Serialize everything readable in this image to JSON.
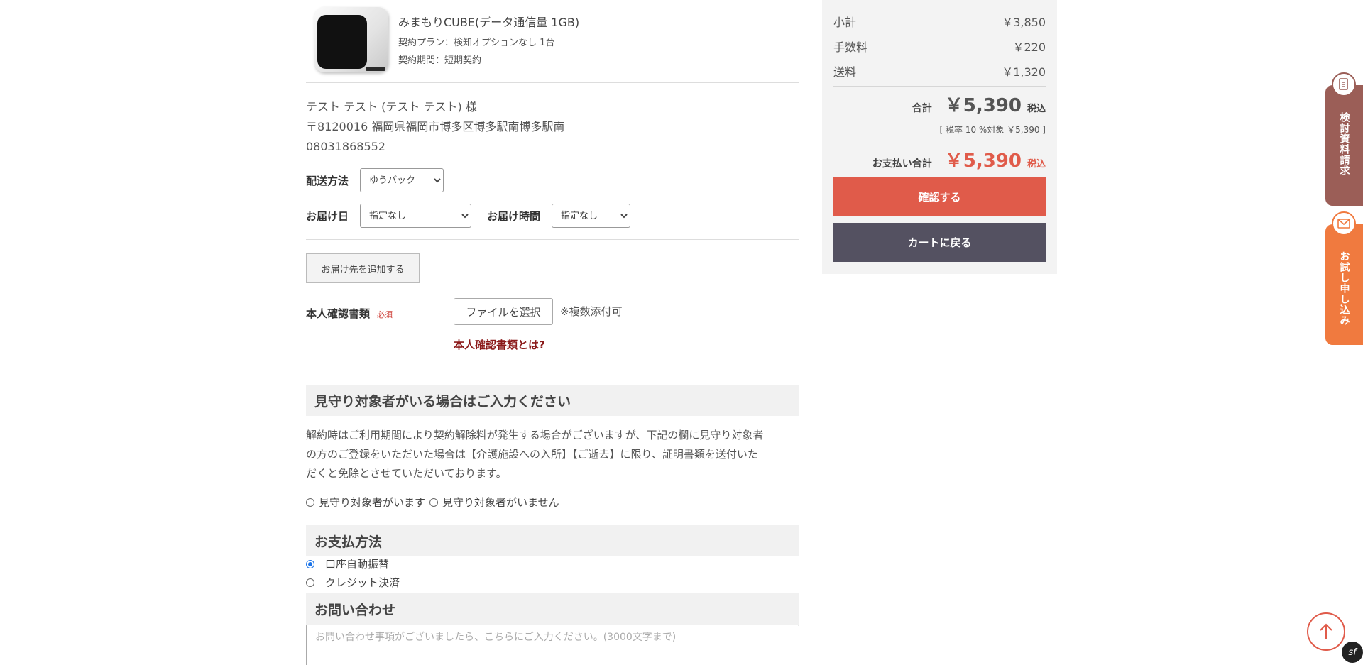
{
  "product": {
    "name": "みまもりCUBE(データ通信量 1GB)",
    "plan": "契約プラン：検知オプションなし 1台",
    "term": "契約期間：短期契約"
  },
  "address": {
    "name": "テスト テスト (テスト テスト) 様",
    "postal_address": "〒8120016 福岡県福岡市博多区博多駅南博多駅南",
    "phone": "08031868552"
  },
  "shipping": {
    "method_label": "配送方法",
    "method_value": "ゆうパック",
    "date_label": "お届け日",
    "date_value": "指定なし",
    "time_label": "お届け時間",
    "time_value": "指定なし",
    "add_destination_label": "お届け先を追加する"
  },
  "identity": {
    "label": "本人確認書類",
    "required": "必須",
    "file_button": "ファイルを選択",
    "note": "※複数添付可",
    "link": "本人確認書類とは?"
  },
  "watch": {
    "heading": "見守り対象者がいる場合はご入力ください",
    "paragraph_line1": "解約時はご利用期間により契約解除料が発生する場合がございますが、下記の欄に見守り対象者",
    "paragraph_line2": "の方のご登録をいただいた場合は【介護施設への入所】【ご逝去】に限り、証明書類を送付いた",
    "paragraph_line3": "だくと免除とさせていただいております。",
    "option_yes": "見守り対象者がいます",
    "option_no": "見守り対象者がいません"
  },
  "payment": {
    "heading": "お支払方法",
    "option_bank": "口座自動振替",
    "option_card": "クレジット決済"
  },
  "inquiry": {
    "heading": "お問い合わせ",
    "placeholder": "お問い合わせ事項がございましたら、こちらにご入力ください。(3000文字まで)"
  },
  "summary": {
    "subtotal_label": "小計",
    "subtotal_value": "￥3,850",
    "fee_label": "手数料",
    "fee_value": "￥220",
    "shipping_label": "送料",
    "shipping_value": "￥1,320",
    "total_label": "合計",
    "total_value": "￥5,390",
    "tax_included": "税込",
    "tax_detail": "[ 税率 10 %対象 ￥5,390 ]",
    "payment_total_label": "お支払い合計",
    "payment_total_value": "￥5,390",
    "confirm_button": "確認する",
    "back_button": "カートに戻る"
  },
  "side_tabs": {
    "document_request": "検討資料請求",
    "trial_application": "お試し申し込み"
  },
  "colors": {
    "accent": "#e05b4a",
    "dark_button": "#545161",
    "doc_tab": "#9b5e57",
    "trial_tab": "#f07a3f"
  },
  "icons": [
    "document-icon",
    "mail-icon",
    "arrow-up-icon",
    "symfony-icon"
  ]
}
